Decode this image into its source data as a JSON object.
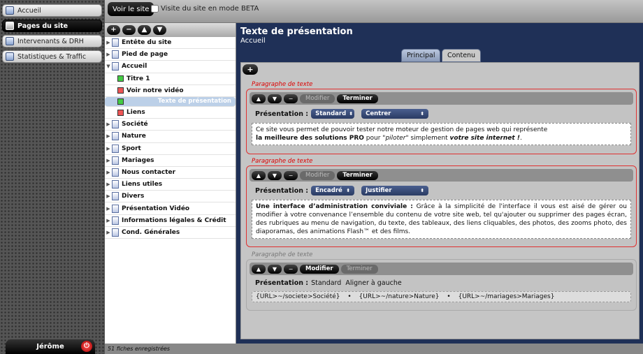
{
  "nav": {
    "items": [
      {
        "label": "Accueil"
      },
      {
        "label": "Pages du site"
      },
      {
        "label": "Intervenants & DRH"
      },
      {
        "label": "Statistiques & Traffic"
      }
    ]
  },
  "user": {
    "name": "Jérôme"
  },
  "topbar": {
    "voir_label": "Voir le site",
    "beta_label": "Visite du site en mode BETA"
  },
  "tree": {
    "toolbar": {
      "add": "+",
      "remove": "−",
      "up": "▲",
      "down": "▼"
    },
    "items": [
      "Entête du site",
      "Pied de page",
      "Accueil",
      "Titre 1",
      "Voir notre vidéo",
      "Texte de présentation",
      "Liens",
      "Société",
      "Nature",
      "Sport",
      "Mariages",
      "Nous contacter",
      "Liens utiles",
      "Divers",
      "Présentation Vidéo",
      "Informations légales & Crédit",
      "Cond. Générales"
    ]
  },
  "footer": {
    "status": "51 fiches enregistrées"
  },
  "content": {
    "title": "Texte de présentation",
    "subtitle": "Accueil",
    "tabs": [
      "Principal",
      "Contenu"
    ],
    "add": "+",
    "paragraph_label": "Paragraphe de texte",
    "btn_modifier": "Modifier",
    "btn_terminer": "Terminer",
    "presentation_label": "Présentation :",
    "blocks": [
      {
        "style": "Standard",
        "align": "Centrer",
        "line1": "Ce site vous permet de pouvoir tester notre moteur de gestion de pages web qui représente",
        "line2_bold": "la meilleure des solutions PRO",
        "line2_a": " pour \"",
        "line2_italic": "piloter",
        "line2_b": "\" simplement ",
        "line2_bolditalic": "votre site internet !",
        "line2_end": "."
      },
      {
        "style": "Encadré",
        "align": "Justifier",
        "lead_bold": "Une interface d’administration conviviale :",
        "text": " Grâce à la simplicité de l'interface il vous est aisé de gérer ou modifier à votre convenance l’ensemble du contenu de votre site web, tel qu'ajouter ou supprimer des pages écran, des rubriques au menu de navigation, du texte, des tableaux, des liens cliquables, des photos, des zooms photo, des diaporamas, des animations Flash™ et des films."
      },
      {
        "presentation_text": "Présentation :",
        "style": "Standard",
        "align": "Aligner à gauche",
        "urls": [
          "{URL>~/societe>Société}",
          "{URL>~/nature>Nature}",
          "{URL>~/mariages>Mariages}"
        ],
        "sep": "•"
      }
    ]
  }
}
